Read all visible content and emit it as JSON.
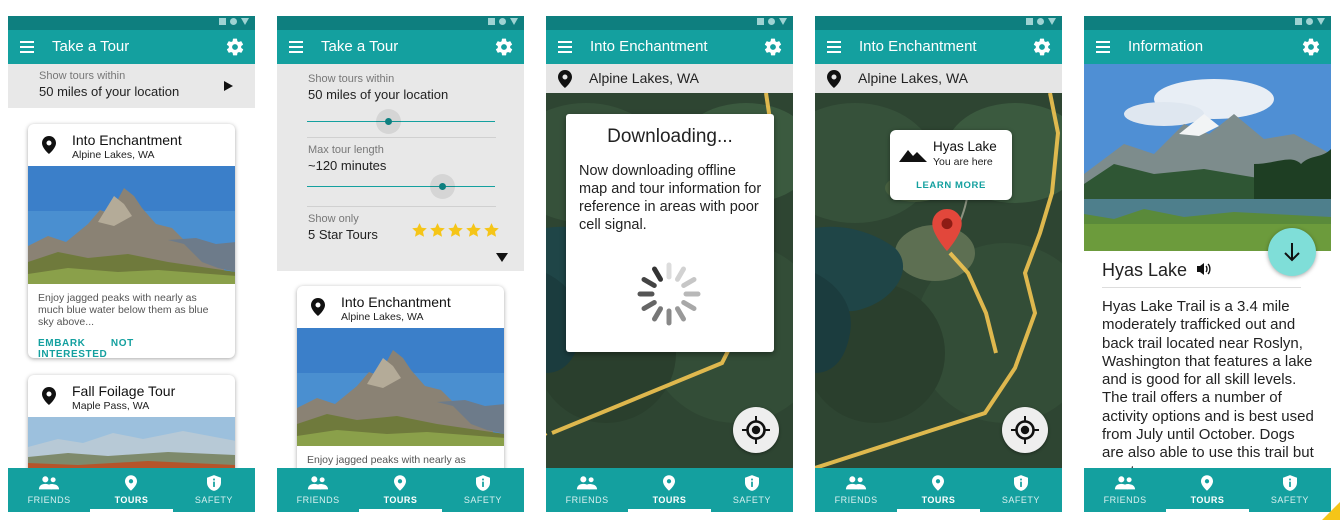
{
  "colors": {
    "primary": "#14a09f",
    "primary_dark": "#0e7f7f",
    "star": "#f5c518",
    "route": "#f2c451",
    "pin": "#e2473b"
  },
  "tabs": {
    "friends": "FRIENDS",
    "tours": "TOURS",
    "safety": "SAFETY",
    "active": "tours"
  },
  "screen1": {
    "title": "Take a Tour",
    "filter_small": "Show tours within",
    "filter_value": "50 miles of your location",
    "card1": {
      "title": "Into Enchantment",
      "location": "Alpine Lakes, WA",
      "description": "Enjoy jagged peaks with nearly as much blue water below them as blue sky above...",
      "embark": "EMBARK",
      "not_interested": "NOT INTERESTED"
    },
    "card2": {
      "title": "Fall Foilage Tour",
      "location": "Maple Pass, WA"
    }
  },
  "screen2": {
    "title": "Take a Tour",
    "filter_small": "Show tours within",
    "filter_value": "50 miles of your location",
    "distance_slider_level": 0.43,
    "length_small": "Max tour length",
    "length_value": "~120 minutes",
    "length_slider_level": 0.72,
    "rating_small": "Show only",
    "rating_value": "5 Star Tours",
    "stars": 5,
    "card": {
      "title": "Into Enchantment",
      "location": "Alpine Lakes, WA",
      "description": "Enjoy jagged peaks with nearly as"
    }
  },
  "screen3": {
    "title": "Into Enchantment",
    "location": "Alpine Lakes, WA",
    "dialog_title": "Downloading...",
    "dialog_body": "Now downloading offline map and tour information for reference in areas with poor cell signal."
  },
  "screen4": {
    "title": "Into Enchantment",
    "location": "Alpine Lakes, WA",
    "popup_title": "Hyas Lake",
    "popup_sub": "You are here",
    "popup_link": "LEARN MORE"
  },
  "screen5": {
    "title": "Information",
    "heading": "Hyas Lake",
    "body": "Hyas Lake Trail is a 3.4 mile moderately trafficked out and back trail located near Roslyn, Washington that features a lake and is good for all skill levels. The trail offers a number of activity options and is best used from July until October. Dogs are also able to use this trail but must"
  }
}
